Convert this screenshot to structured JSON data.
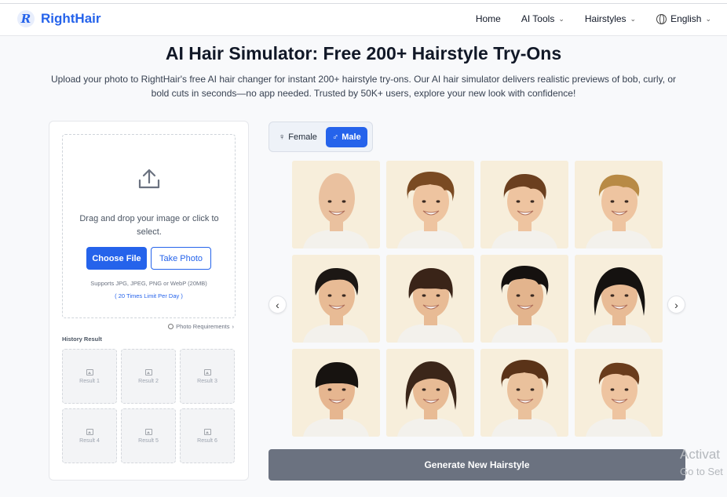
{
  "brand": {
    "logo_letter": "R",
    "name": "RightHair",
    "accent": "#2563eb"
  },
  "nav": {
    "home": "Home",
    "ai_tools": "AI Tools",
    "hairstyles": "Hairstyles",
    "language": "English"
  },
  "hero": {
    "title": "AI Hair Simulator: Free 200+ Hairstyle Try-Ons",
    "description": "Upload your photo to RightHair's free AI hair changer for instant 200+ hairstyle try-ons. Our AI hair simulator delivers realistic previews of bob, curly, or bold cuts in seconds—no app needed. Trusted by 50K+ users, explore your new look with confidence!"
  },
  "upload": {
    "drop_text": "Drag and drop your image or click to select.",
    "choose_file": "Choose File",
    "take_photo": "Take Photo",
    "supports": "Supports JPG, JPEG, PNG or WebP (20MB)",
    "limit": "( 20 Times Limit Per Day )",
    "photo_requirements": "Photo Requirements",
    "history_title": "History Result",
    "history": [
      "Result 1",
      "Result 2",
      "Result 3",
      "Result 4",
      "Result 5",
      "Result 6"
    ]
  },
  "gender": {
    "female": "Female",
    "male": "Male",
    "female_symbol": "♀",
    "male_symbol": "♂",
    "selected": "Male"
  },
  "hairstyles": [
    {
      "name": "bald",
      "hair_color": "#e9c9a6",
      "skin": "#eac19f",
      "shape": "bald"
    },
    {
      "name": "curly-brown",
      "hair_color": "#7a4a22",
      "skin": "#eec4a0",
      "shape": "curly"
    },
    {
      "name": "wavy-brown",
      "hair_color": "#6b3f1f",
      "skin": "#eec4a0",
      "shape": "wavy"
    },
    {
      "name": "blonde-textured",
      "hair_color": "#b88a45",
      "skin": "#eec4a0",
      "shape": "textured"
    },
    {
      "name": "black-side-part",
      "hair_color": "#1c1714",
      "skin": "#e8bb95",
      "shape": "sidepart"
    },
    {
      "name": "brown-fringe",
      "hair_color": "#3a2418",
      "skin": "#e8bb95",
      "shape": "fringe"
    },
    {
      "name": "black-curly-top",
      "hair_color": "#15110f",
      "skin": "#e3b48d",
      "shape": "curly"
    },
    {
      "name": "black-long-wavy",
      "hair_color": "#151210",
      "skin": "#e8bb95",
      "shape": "long"
    },
    {
      "name": "black-bowl",
      "hair_color": "#171310",
      "skin": "#e6b690",
      "shape": "bowl"
    },
    {
      "name": "brown-shoulder",
      "hair_color": "#3b2619",
      "skin": "#e8bb95",
      "shape": "long"
    },
    {
      "name": "brown-curly-volume",
      "hair_color": "#5a3318",
      "skin": "#eac19c",
      "shape": "curly"
    },
    {
      "name": "brown-curly-short",
      "hair_color": "#6a3c1c",
      "skin": "#eec4a0",
      "shape": "textured"
    }
  ],
  "generate_label": "Generate New Hairstyle",
  "os_watermark": {
    "line1": "Activat",
    "line2": "Go to Set"
  }
}
